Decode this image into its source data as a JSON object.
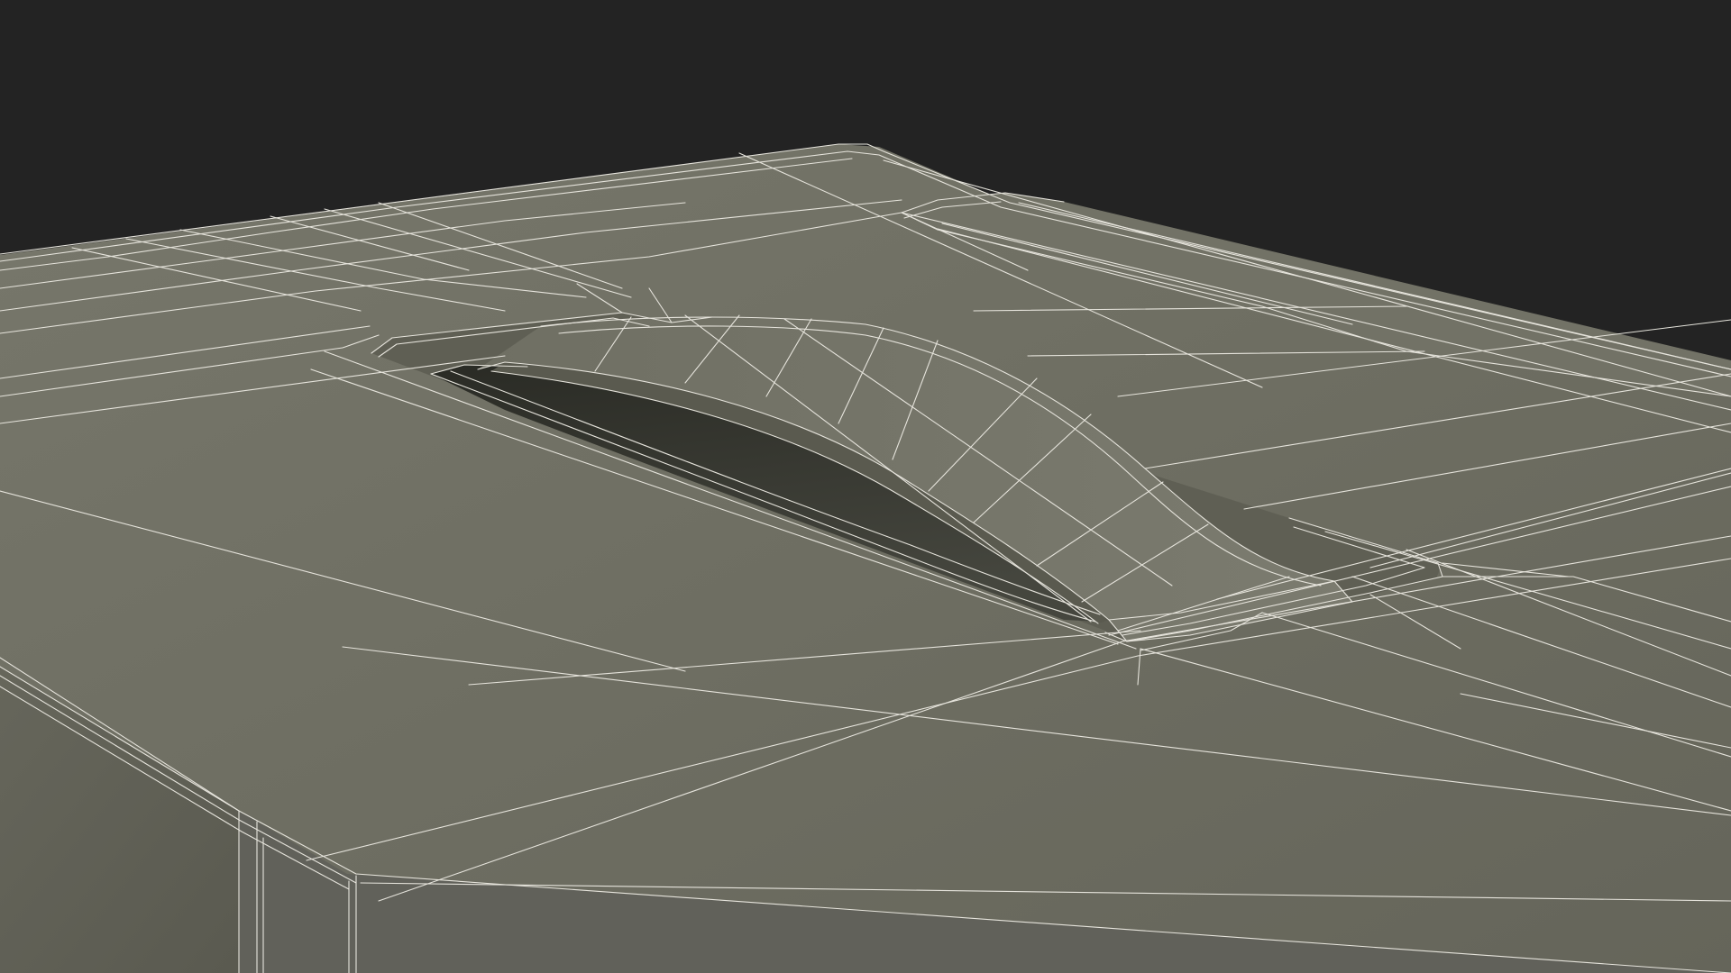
{
  "scene": {
    "subject": "",
    "colors": {
      "background": "#232323",
      "surface_light": "#747468",
      "surface_mid": "#6b6b5f",
      "surface_dark": "#5c5c51",
      "cavity": "#2f3029",
      "wireframe": "#e6e4dc"
    }
  }
}
